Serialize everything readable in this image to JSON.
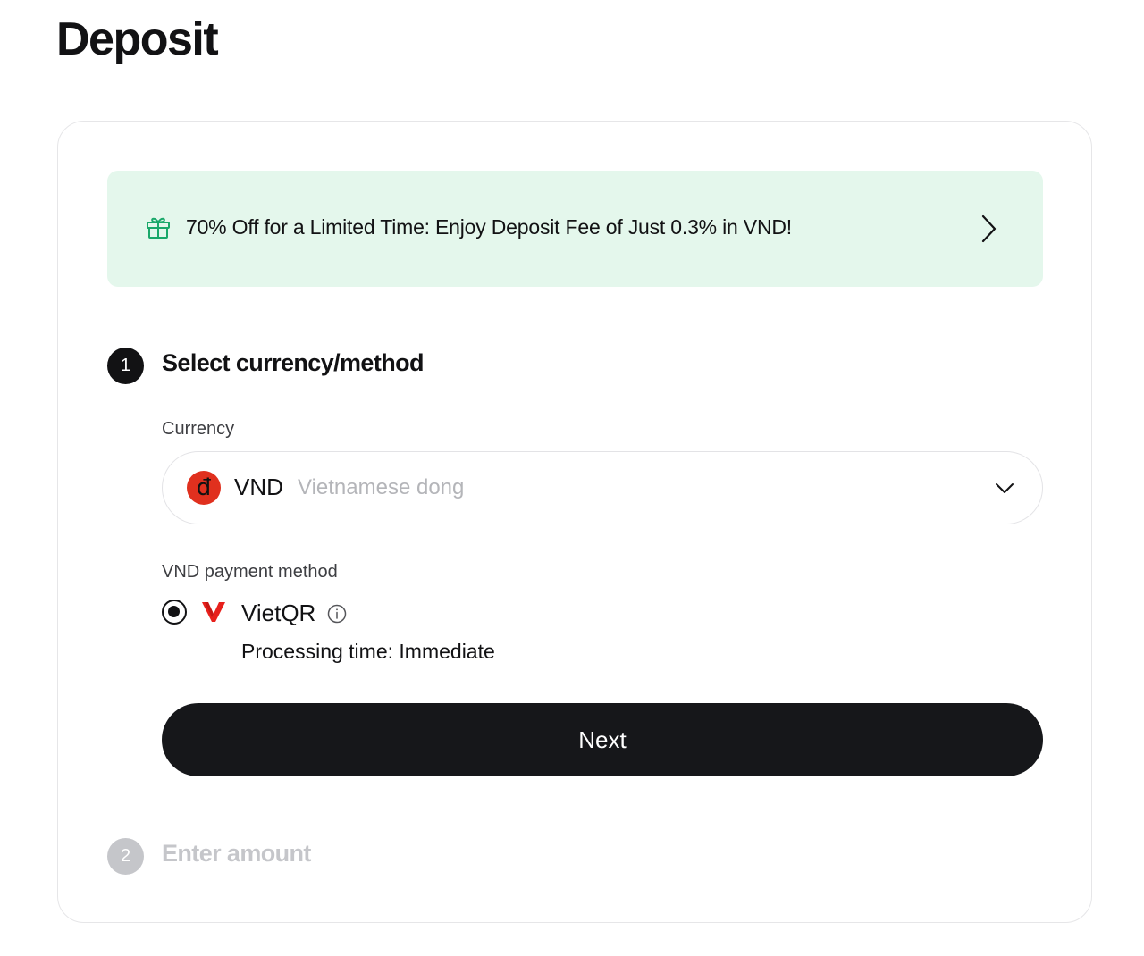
{
  "page": {
    "title": "Deposit"
  },
  "promo": {
    "icon": "gift-icon",
    "text": "70% Off for a Limited Time: Enjoy Deposit Fee of Just 0.3% in VND!",
    "accent_color": "#1aa86a",
    "background_color": "#e4f7ec"
  },
  "steps": [
    {
      "number": "1",
      "title": "Select currency/method",
      "active": true,
      "currency": {
        "label": "Currency",
        "selected_code": "VND",
        "selected_name": "Vietnamese dong",
        "icon_glyph": "đ",
        "icon_color": "#e0301e"
      },
      "payment_method": {
        "label": "VND payment method",
        "options": [
          {
            "name": "VietQR",
            "selected": true,
            "processing_time": "Processing time: Immediate",
            "logo_color": "#e8201c"
          }
        ]
      },
      "next_label": "Next"
    },
    {
      "number": "2",
      "title": "Enter amount",
      "active": false
    }
  ]
}
